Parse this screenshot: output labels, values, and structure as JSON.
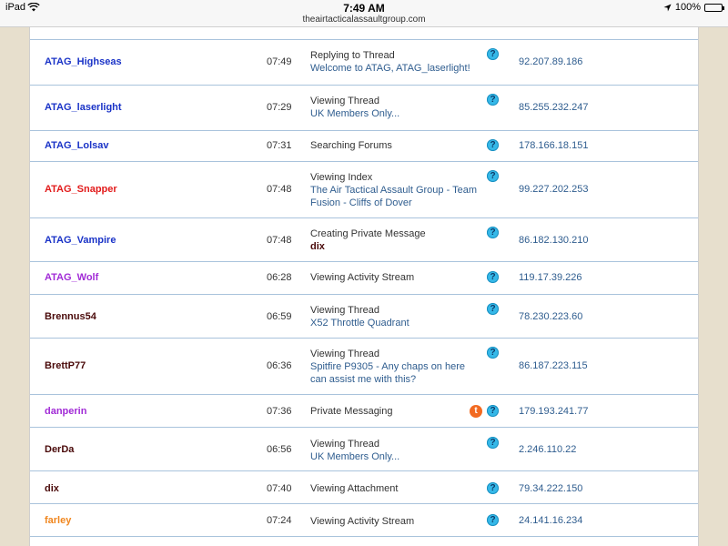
{
  "status_bar": {
    "device": "iPad",
    "time": "7:49 AM",
    "url": "theairtacticalassaultgroup.com",
    "battery": "100%"
  },
  "rows": [
    {
      "user": "ATAG_Highseas",
      "time": "07:49",
      "activity": "Replying to Thread",
      "link": "Welcome to ATAG, ATAG_laserlight!",
      "ip": "92.207.89.186"
    },
    {
      "user": "ATAG_laserlight",
      "time": "07:29",
      "activity": "Viewing Thread",
      "link": "UK Members Only...",
      "ip": "85.255.232.247"
    },
    {
      "user": "ATAG_Lolsav",
      "time": "07:31",
      "activity": "Searching Forums",
      "ip": "178.166.18.151"
    },
    {
      "user": "ATAG_Snapper",
      "time": "07:48",
      "activity": "Viewing Index",
      "link": "The Air Tactical Assault Group - Team Fusion - Cliffs of Dover",
      "ip": "99.227.202.253"
    },
    {
      "user": "ATAG_Vampire",
      "time": "07:48",
      "activity": "Creating Private Message",
      "target": "dix",
      "ip": "86.182.130.210"
    },
    {
      "user": "ATAG_Wolf",
      "time": "06:28",
      "activity": "Viewing Activity Stream",
      "ip": "119.17.39.226"
    },
    {
      "user": "Brennus54",
      "time": "06:59",
      "activity": "Viewing Thread",
      "link": "X52 Throttle Quadrant",
      "ip": "78.230.223.60"
    },
    {
      "user": "BrettP77",
      "time": "06:36",
      "activity": "Viewing Thread",
      "link": "Spitfire P9305 - Any chaps on here can assist me with this?",
      "ip": "86.187.223.115"
    },
    {
      "user": "danperin",
      "time": "07:36",
      "activity": "Private Messaging",
      "ip": "179.193.241.77"
    },
    {
      "user": "DerDa",
      "time": "06:56",
      "activity": "Viewing Thread",
      "link": "UK Members Only...",
      "ip": "2.246.110.22"
    },
    {
      "user": "dix",
      "time": "07:40",
      "activity": "Viewing Attachment",
      "ip": "79.34.222.150"
    },
    {
      "user": "farley",
      "time": "07:24",
      "activity": "Viewing Activity Stream",
      "ip": "24.141.16.234"
    }
  ],
  "icons": {
    "help": "?",
    "tapatalk": "t"
  },
  "colors": {
    "member_blue": "#1a33c7",
    "member_red": "#e21b1b",
    "member_purple": "#a12bd6",
    "member_dark": "#4a0a0a",
    "member_orange": "#f0861e",
    "link": "#2f5d8f",
    "divider": "#a9c3dc"
  }
}
